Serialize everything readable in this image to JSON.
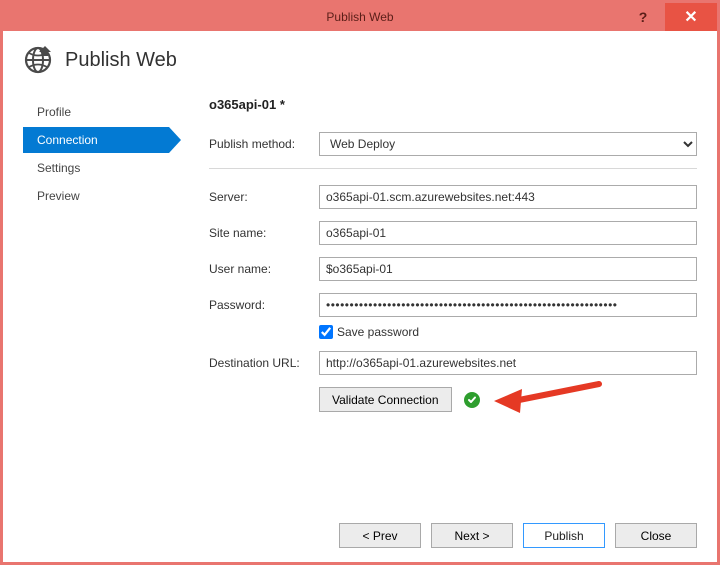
{
  "window": {
    "title": "Publish Web"
  },
  "header": {
    "title": "Publish Web"
  },
  "sidebar": {
    "items": [
      {
        "label": "Profile",
        "active": false
      },
      {
        "label": "Connection",
        "active": true
      },
      {
        "label": "Settings",
        "active": false
      },
      {
        "label": "Preview",
        "active": false
      }
    ]
  },
  "profile": {
    "name": "o365api-01 *"
  },
  "labels": {
    "publish_method": "Publish method:",
    "server": "Server:",
    "site_name": "Site name:",
    "user_name": "User name:",
    "password": "Password:",
    "destination_url": "Destination URL:",
    "save_password": "Save password"
  },
  "values": {
    "publish_method": "Web Deploy",
    "server": "o365api-01.scm.azurewebsites.net:443",
    "site_name": "o365api-01",
    "user_name": "$o365api-01",
    "password": "••••••••••••••••••••••••••••••••••••••••••••••••••••••••••••••",
    "save_password_checked": true,
    "destination_url": "http://o365api-01.azurewebsites.net"
  },
  "buttons": {
    "validate": "Validate Connection",
    "prev": "< Prev",
    "next": "Next >",
    "publish": "Publish",
    "close": "Close"
  }
}
